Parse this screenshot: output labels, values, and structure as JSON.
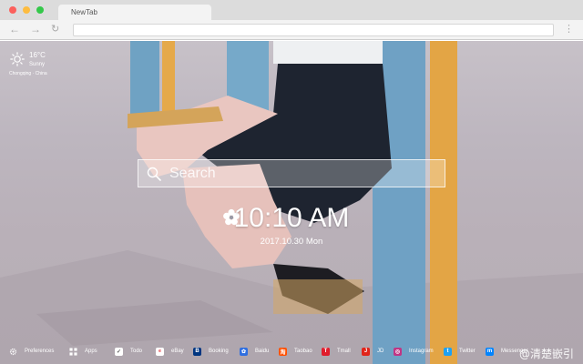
{
  "browser": {
    "tab_title": "NewTab",
    "nav": {
      "back": "←",
      "forward": "→",
      "reload": "↻",
      "menu": "⋮"
    }
  },
  "weather": {
    "temperature": "16°C",
    "condition": "Sunny",
    "location": "Chongqing · China",
    "icon": "sun-icon"
  },
  "search": {
    "placeholder": "Search",
    "icon": "search-icon"
  },
  "clock": {
    "time": "10:10 AM",
    "date": "2017.10.30 Mon",
    "icon": "flower-icon"
  },
  "bottom_bar": {
    "items": [
      {
        "label": "Preferences",
        "icon": "gear-icon",
        "color": "#ffffff"
      },
      {
        "label": "Apps",
        "icon": "grid-icon",
        "color": "#ffffff"
      },
      {
        "label": "Todo",
        "icon": "checkbox-icon",
        "color": "#ffffff"
      },
      {
        "label": "eBay",
        "icon": "ebay-icon",
        "color": "#ffffff"
      },
      {
        "label": "Booking",
        "icon": "booking-icon",
        "color": "#003580"
      },
      {
        "label": "Baidu",
        "icon": "baidu-icon",
        "color": "#2f6fe0"
      },
      {
        "label": "Taobao",
        "icon": "taobao-icon",
        "color": "#ff5000"
      },
      {
        "label": "Tmall",
        "icon": "tmall-icon",
        "color": "#e01c2c"
      },
      {
        "label": "JD",
        "icon": "jd-icon",
        "color": "#e1251b"
      },
      {
        "label": "Instagram",
        "icon": "instagram-icon",
        "color": "#c13584"
      },
      {
        "label": "Twitter",
        "icon": "twitter-icon",
        "color": "#1da1f2"
      },
      {
        "label": "Messenger",
        "icon": "messenger-icon",
        "color": "#0084ff"
      }
    ]
  },
  "watermark": "@清楚嵌引"
}
